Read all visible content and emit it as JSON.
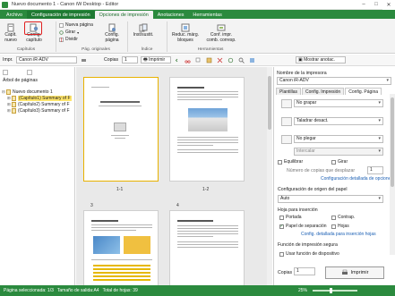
{
  "window": {
    "title": "Nuevo documento 1 - Canon iW Desktop - Editor"
  },
  "ribbon_tabs": [
    {
      "label": "Archivo",
      "state": "normal"
    },
    {
      "label": "Configuración de impresión",
      "state": "hl"
    },
    {
      "label": "Opciones de impresión",
      "state": "active"
    },
    {
      "label": "Anotaciones",
      "state": "normal"
    },
    {
      "label": "Herramientas",
      "state": "normal"
    }
  ],
  "ribbon": {
    "capitulo_nuevo": "Capít. nuevo",
    "config_capitulo": "Config. capítulo",
    "nueva_pagina": "Nueva página",
    "girar": "Girar",
    "dividir": "Dividir",
    "config_pagina": "Config. página",
    "inst_sustit": "Inst/sustit.",
    "reduc_marg": "Reduc. márg. bloques",
    "conf_impr_comb": "Conf. impr. comb. corresp.",
    "groups": {
      "capitulos": "Capítulos",
      "pag_originales": "Pág. originales",
      "indice": "Índice",
      "herramientas": "Herramientas"
    }
  },
  "toolbar": {
    "impr_label": "Impr.",
    "printer": "Canon iR-ADV",
    "copies_label": "Copias",
    "copies_value": "1",
    "print_btn": "Imprimir",
    "mostrar_anot": "Mostrar anotac."
  },
  "left_pane": {
    "title": "Árbol de páginas",
    "tree": [
      {
        "label": "Nuevo documento 1",
        "toggle": "⊟",
        "indent": 0,
        "hl": false
      },
      {
        "label": "(Capítulo1) Summary of F",
        "toggle": "⊞",
        "indent": 1,
        "hl": true
      },
      {
        "label": "(Capítulo2) Summary of F",
        "toggle": "⊞",
        "indent": 1,
        "hl": false
      },
      {
        "label": "(Capítulo3) Summary of F",
        "toggle": "⊞",
        "indent": 1,
        "hl": false
      }
    ]
  },
  "center": {
    "pages": [
      {
        "num": "1-1"
      },
      {
        "num": "1-2"
      },
      {
        "num": "3"
      },
      {
        "num": "4"
      }
    ]
  },
  "right_pane": {
    "printer_label": "Nombre de la impresora",
    "printer": "Canon iR-ADV",
    "tabs": [
      "Plantillas",
      "Config. Impresión",
      "Config. Página"
    ],
    "no_grapar": "No grapar",
    "taladrar": "Taladrar desact.",
    "no_plegar": "No plegar",
    "intercalar": "Intercalar",
    "equilibrar": "Equilibrar",
    "girar": "Girar",
    "num_copias_label": "Número de copias que desplazar",
    "num_copias_value": "1",
    "config_detallada_1": "Configuración detallada de opciones",
    "config_origen": "Configuración de origen del papel",
    "auto": "Auto",
    "hoja_insercion": "Hoja para inserción",
    "portada": "Portada",
    "contraportada": "Contrap.",
    "papel_sep": "Papel de separación",
    "hojas": "Hojas",
    "config_detallada_2": "Config. detallada para inserción hojas",
    "funcion_segura": "Función de impresión segura",
    "usar_funcion": "Usar función de dispositivo",
    "copias_label": "Copias",
    "copias_value": "1",
    "imprimir": "Imprimir"
  },
  "status": {
    "pagina_sel": "Página seleccionada: 1/3",
    "tamano": "Tamaño de salida:A4",
    "total": "Total de hojas: 39",
    "zoom": "25%"
  }
}
